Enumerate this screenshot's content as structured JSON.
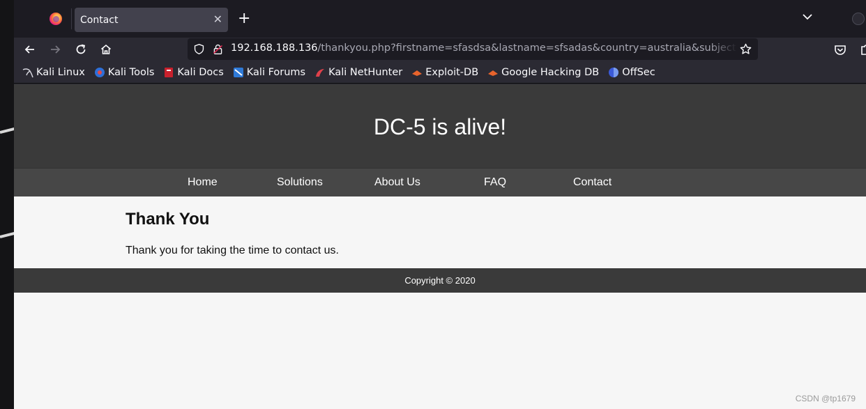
{
  "browser": {
    "tab": {
      "title": "Contact"
    },
    "url": {
      "host": "192.168.188.136",
      "path": "/thankyou.php?firstname=sfasdsa&lastname=sfsadas&country=australia&subject=sfasdas"
    },
    "bookmarks": [
      {
        "label": "Kali Linux",
        "icon": "kali-dragon-icon"
      },
      {
        "label": "Kali Tools",
        "icon": "kali-tools-icon"
      },
      {
        "label": "Kali Docs",
        "icon": "kali-docs-icon"
      },
      {
        "label": "Kali Forums",
        "icon": "kali-forums-icon"
      },
      {
        "label": "Kali NetHunter",
        "icon": "nethunter-icon"
      },
      {
        "label": "Exploit-DB",
        "icon": "exploit-db-icon"
      },
      {
        "label": "Google Hacking DB",
        "icon": "ghdb-icon"
      },
      {
        "label": "OffSec",
        "icon": "offsec-icon"
      }
    ]
  },
  "page": {
    "site_title": "DC-5 is alive!",
    "nav": [
      "Home",
      "Solutions",
      "About Us",
      "FAQ",
      "Contact"
    ],
    "heading": "Thank You",
    "message": "Thank you for taking the time to contact us.",
    "footer": "Copyright © 2020"
  },
  "watermark": "CSDN @tp1679"
}
